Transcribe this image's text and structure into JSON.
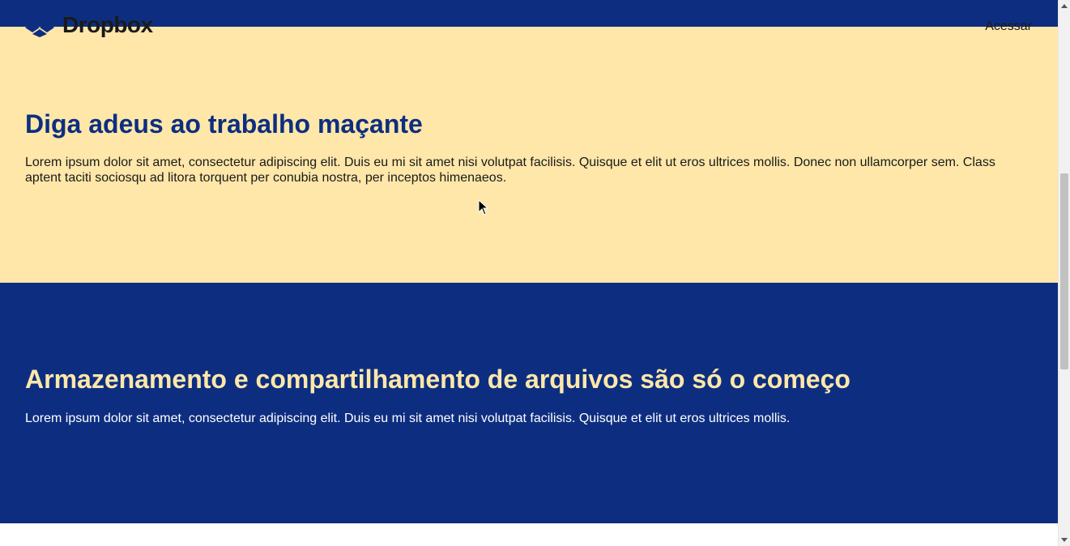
{
  "header": {
    "brand": "Dropbox",
    "login_label": "Acessar",
    "logo_icon": "dropbox-logo-icon"
  },
  "sections": [
    {
      "title": "Diga adeus ao trabalho maçante",
      "text": "Lorem ipsum dolor sit amet, consectetur adipiscing elit. Duis eu mi sit amet nisi volutpat facilisis. Quisque et elit ut eros ultrices mollis. Donec non ullamcorper sem. Class aptent taciti sociosqu ad litora torquent per conubia nostra, per inceptos himenaeos."
    },
    {
      "title": "Armazenamento e compartilhamento de arquivos são só o começo",
      "text": "Lorem ipsum dolor sit amet, consectetur adipiscing elit. Duis eu mi sit amet nisi volutpat facilisis. Quisque et elit ut eros ultrices mollis."
    }
  ],
  "colors": {
    "brand_blue": "#0d2e80",
    "cream": "#fee7a9",
    "text_dark": "#1a1a1a",
    "white": "#ffffff"
  }
}
